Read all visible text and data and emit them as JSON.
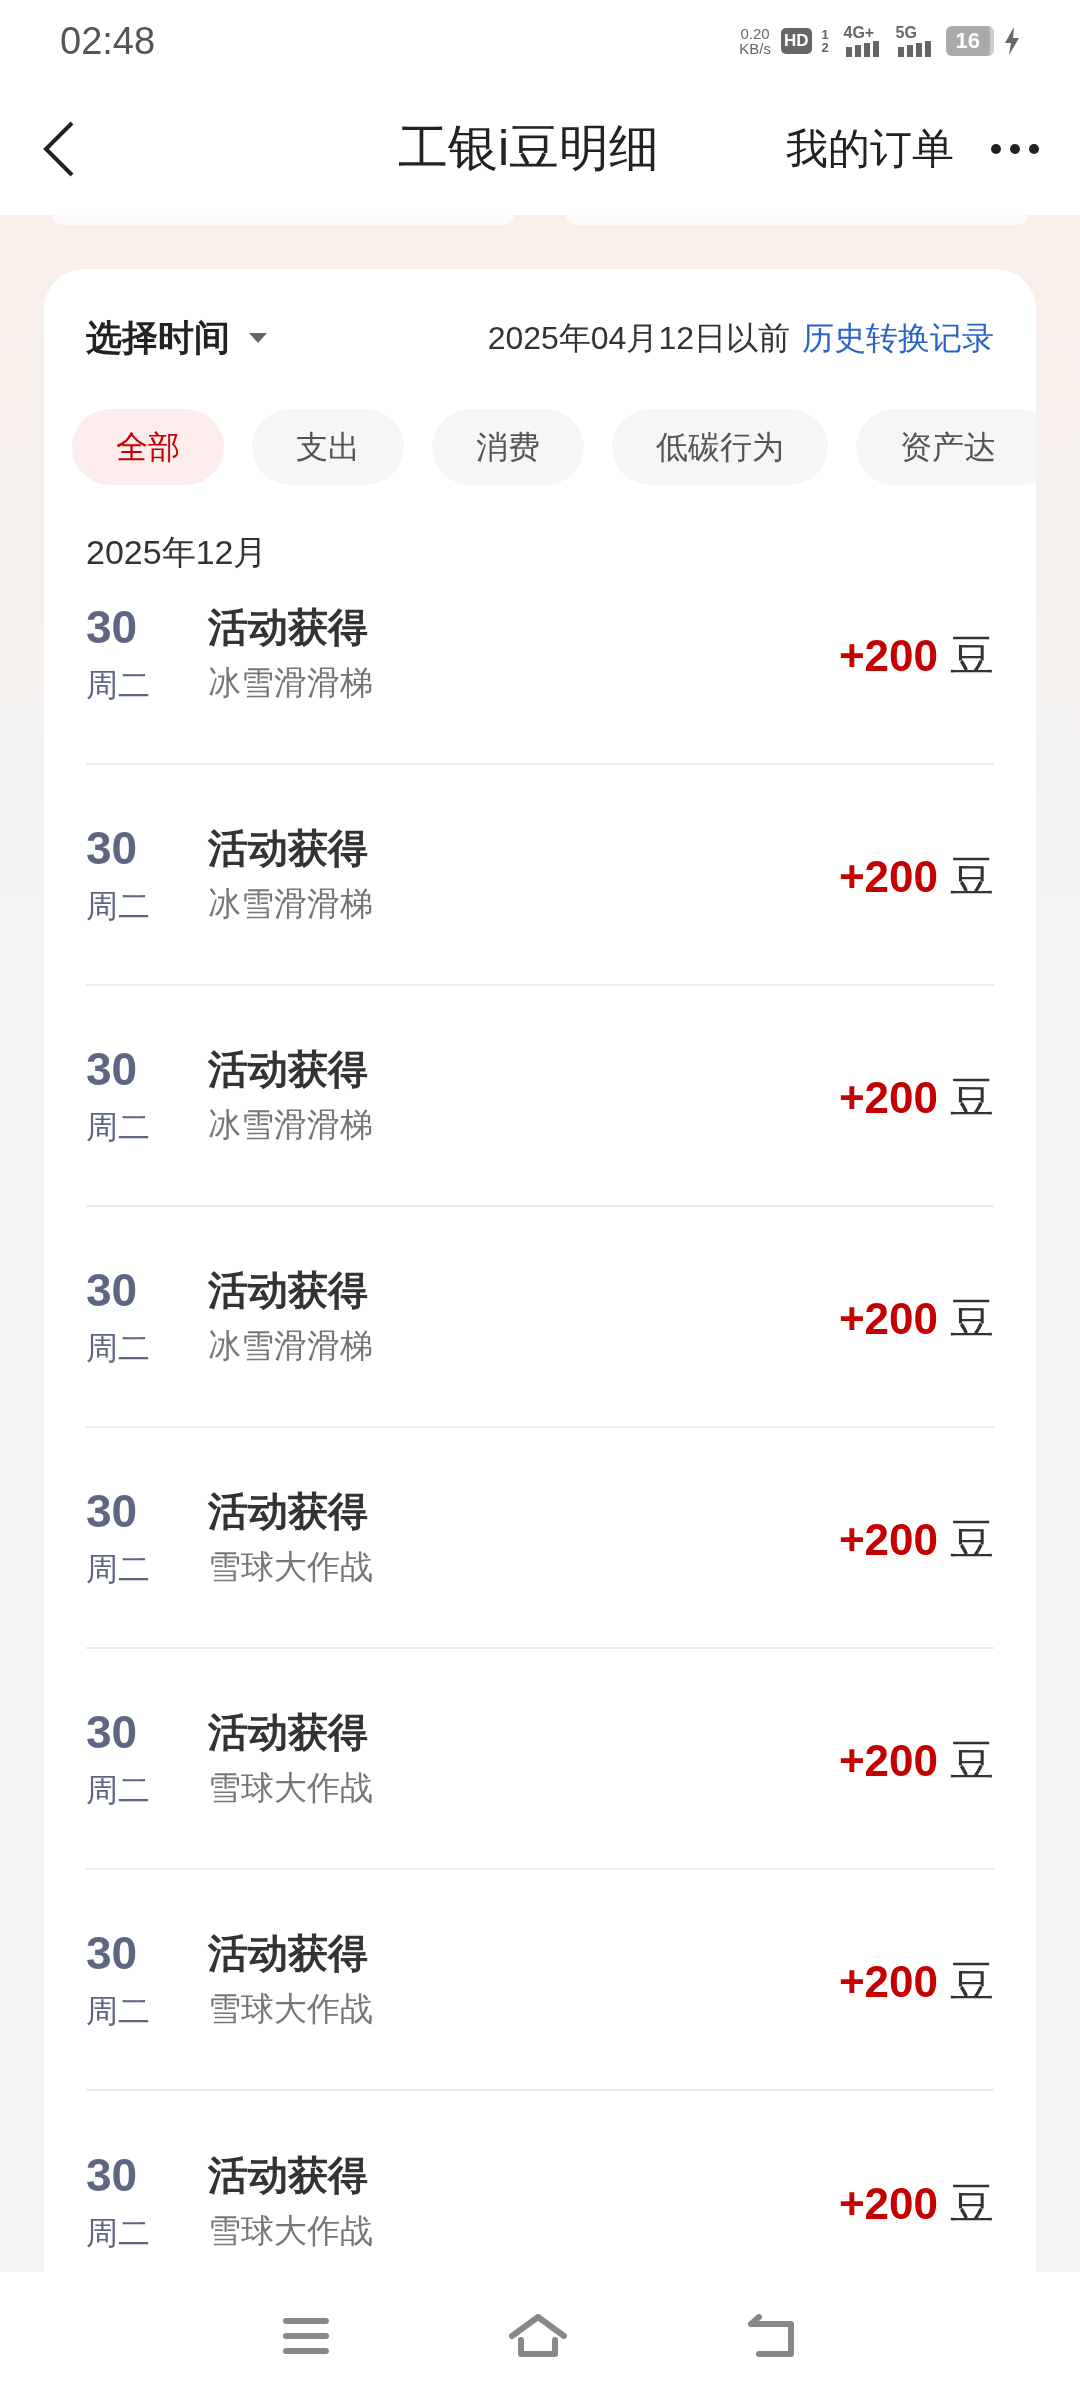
{
  "status_bar": {
    "time": "02:48",
    "net_speed": "0.20",
    "net_unit": "KB/s",
    "hd": "HD",
    "sim_slots": "1 2",
    "networks": [
      "4G+",
      "5G"
    ],
    "battery": "16"
  },
  "header": {
    "title": "工银i豆明细",
    "orders_link": "我的订单"
  },
  "filter_bar": {
    "time_picker": "选择时间",
    "date_note": "2025年04月12日以前",
    "history_link": "历史转换记录"
  },
  "tabs": [
    {
      "label": "全部",
      "selected": true
    },
    {
      "label": "支出",
      "selected": false
    },
    {
      "label": "消费",
      "selected": false
    },
    {
      "label": "低碳行为",
      "selected": false
    },
    {
      "label": "资产达",
      "selected": false
    }
  ],
  "month": "2025年12月",
  "records": [
    {
      "day": "30",
      "weekday": "周二",
      "title": "活动获得",
      "detail": "冰雪滑滑梯",
      "amount": "+200",
      "unit": "豆"
    },
    {
      "day": "30",
      "weekday": "周二",
      "title": "活动获得",
      "detail": "冰雪滑滑梯",
      "amount": "+200",
      "unit": "豆"
    },
    {
      "day": "30",
      "weekday": "周二",
      "title": "活动获得",
      "detail": "冰雪滑滑梯",
      "amount": "+200",
      "unit": "豆"
    },
    {
      "day": "30",
      "weekday": "周二",
      "title": "活动获得",
      "detail": "冰雪滑滑梯",
      "amount": "+200",
      "unit": "豆"
    },
    {
      "day": "30",
      "weekday": "周二",
      "title": "活动获得",
      "detail": "雪球大作战",
      "amount": "+200",
      "unit": "豆"
    },
    {
      "day": "30",
      "weekday": "周二",
      "title": "活动获得",
      "detail": "雪球大作战",
      "amount": "+200",
      "unit": "豆"
    },
    {
      "day": "30",
      "weekday": "周二",
      "title": "活动获得",
      "detail": "雪球大作战",
      "amount": "+200",
      "unit": "豆"
    },
    {
      "day": "30",
      "weekday": "周二",
      "title": "活动获得",
      "detail": "雪球大作战",
      "amount": "+200",
      "unit": "豆"
    }
  ]
}
